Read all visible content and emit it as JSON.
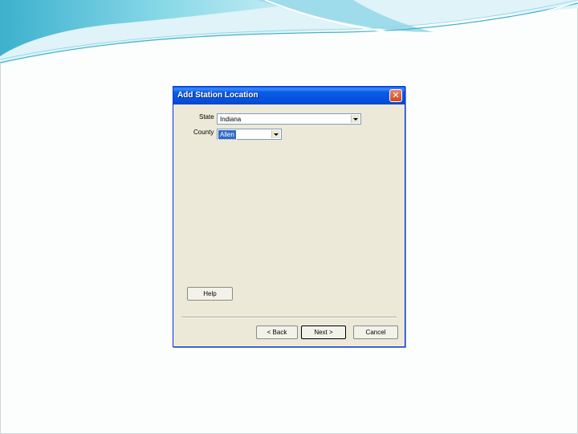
{
  "dialog": {
    "title": "Add Station Location",
    "close_glyph": "✕",
    "fields": {
      "state": {
        "label": "State",
        "value": "Indiana"
      },
      "county": {
        "label": "County",
        "value": "Allen"
      }
    },
    "buttons": {
      "help": "Help",
      "back": "< Back",
      "next": "Next >",
      "cancel": "Cancel"
    }
  },
  "colors": {
    "titlebar": "#0a5ce6",
    "dialog_bg": "#ece9d8",
    "selection": "#316ac5",
    "swoosh": "#56c4d8"
  },
  "icons": {
    "close": "close-icon",
    "dropdown": "chevron-down-icon"
  }
}
